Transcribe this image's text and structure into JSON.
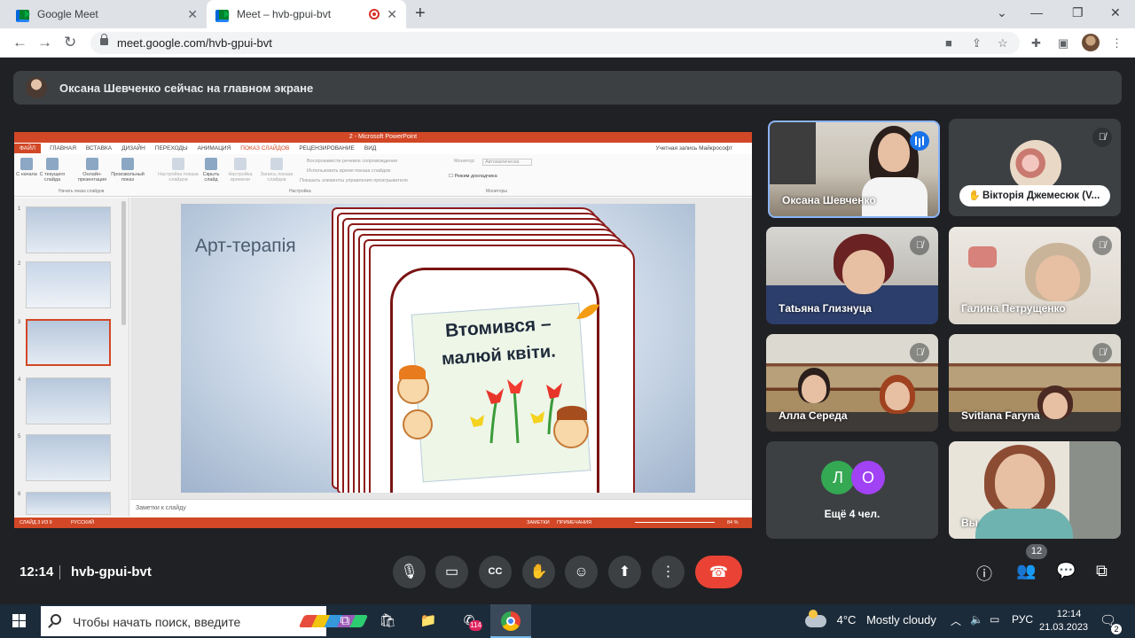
{
  "browser": {
    "tabs": [
      {
        "title": "Google Meet"
      },
      {
        "title": "Meet – hvb-gpui-bvt"
      }
    ],
    "url": "meet.google.com/hvb-gpui-bvt"
  },
  "meet": {
    "presenter_banner": "Оксана Шевченко сейчас на главном экране",
    "meeting_time": "12:14",
    "meeting_code": "hvb-gpui-bvt",
    "participants_count": "12",
    "participants": [
      {
        "name": "Оксана Шевченко",
        "speaking": true
      },
      {
        "name": "Вікторія Джемесюк (V...",
        "muted": true
      },
      {
        "name": "Тatьяна Глизнуца",
        "muted": true
      },
      {
        "name": "Галина Петрущенко",
        "muted": true
      },
      {
        "name": "Алла Середа",
        "muted": true
      },
      {
        "name": "Svitlana Faryna",
        "muted": true
      },
      {
        "name": "Вы"
      }
    ],
    "more": {
      "initials": [
        "Л",
        "О"
      ],
      "label": "Ещё 4 чел."
    },
    "colors": {
      "accent": "#8ab4f8",
      "end_call": "#ea4335",
      "speaking": "#1a73e8"
    }
  },
  "powerpoint": {
    "title": "2 - Microsoft PowerPoint",
    "tabs": [
      "ФАЙЛ",
      "ГЛАВНАЯ",
      "ВСТАВКА",
      "ДИЗАЙН",
      "ПЕРЕХОДЫ",
      "АНИМАЦИЯ",
      "ПОКАЗ СЛАЙДОВ",
      "РЕЦЕНЗИРОВАНИЕ",
      "ВИД"
    ],
    "account": "Учетная запись Майкрософт",
    "ribbon": {
      "btn_start": "С начала",
      "btn_current": "С текущего слайда",
      "btn_online": "Онлайн-презентация",
      "btn_custom": "Произвольный показ",
      "btn_setup": "Настройка показа слайдов",
      "btn_hide": "Скрыть слайд",
      "btn_timing": "Настройка времени",
      "btn_record": "Запись показа слайдов",
      "opt_narration": "Воспроизвести речевое сопровождение",
      "opt_timings": "Использовать время показа слайдов",
      "opt_controls": "Показать элементы управления проигрывателя",
      "monitor_label": "Монитор:",
      "monitor_value": "Автоматически",
      "presenter_view": "Режим докладчика",
      "group_start": "Начать показ слайдов",
      "group_setup": "Настройка",
      "group_monitors": "Мониторы"
    },
    "slide_title": "Арт-терапія",
    "card_text_line1": "Втомився –",
    "card_text_line2": "малюй квіти.",
    "notes_placeholder": "Заметки к слайду",
    "status_left": "СЛАЙД 3 ИЗ 9",
    "status_lang": "РУССКИЙ",
    "status_notes": "ЗАМЕТКИ",
    "status_comments": "ПРИМЕЧАНИЯ",
    "zoom": "84 %",
    "thumbnail_numbers": [
      "1",
      "2",
      "3",
      "4",
      "5",
      "6"
    ]
  },
  "taskbar": {
    "search_placeholder": "Чтобы начать поиск, введите",
    "weather_temp": "4°C",
    "weather_text": "Mostly cloudy",
    "language": "РУС",
    "time": "12:14",
    "date": "21.03.2023",
    "viber_badge": "114",
    "notifications": "2"
  }
}
